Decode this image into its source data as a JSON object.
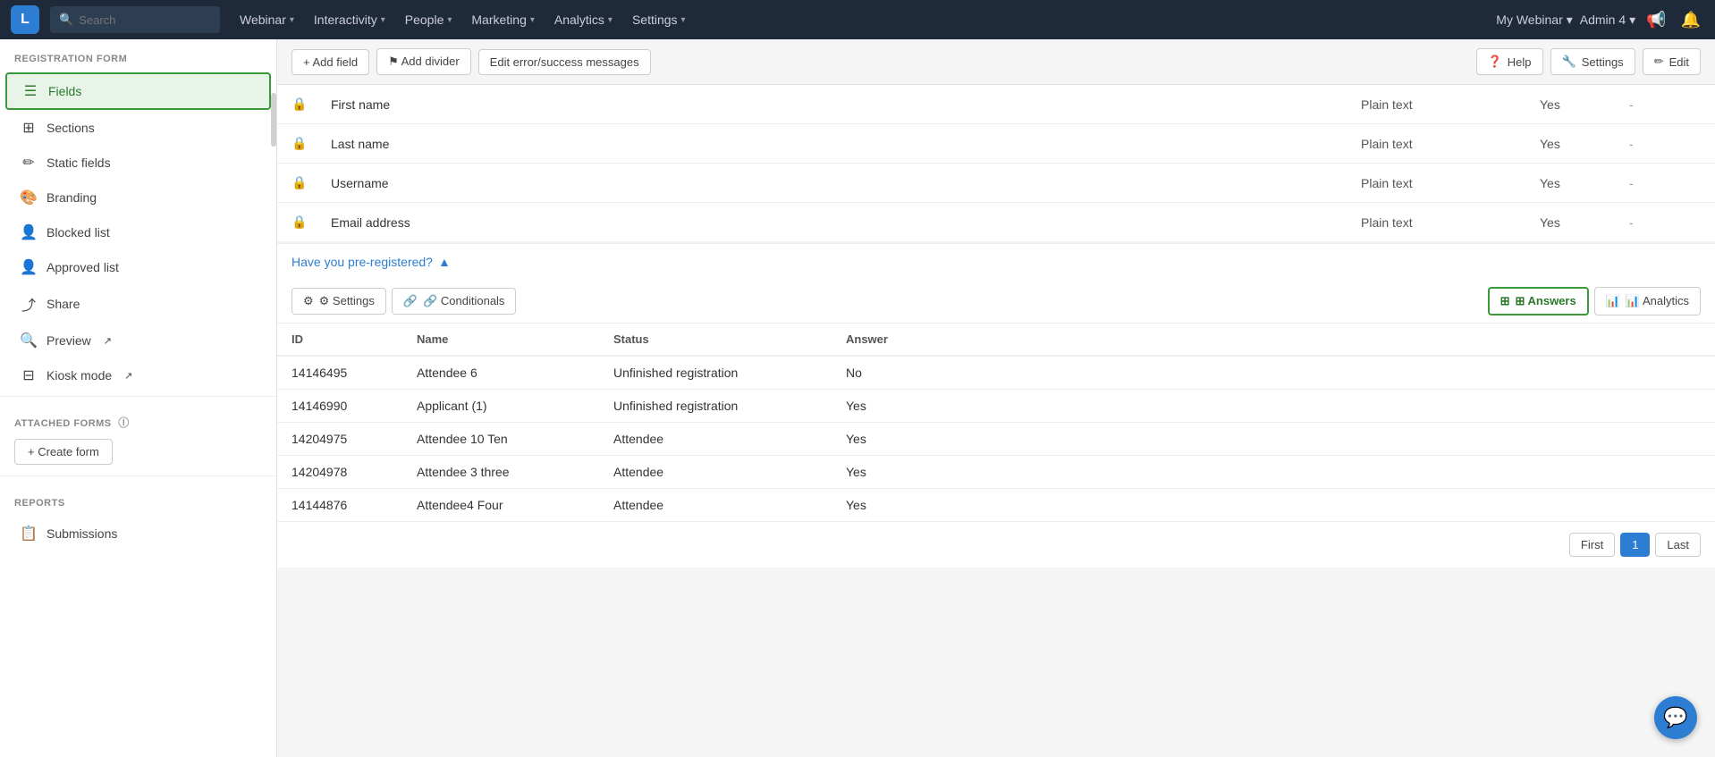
{
  "topnav": {
    "logo": "L",
    "search_placeholder": "Search",
    "nav_items": [
      {
        "label": "Webinar",
        "id": "webinar"
      },
      {
        "label": "Interactivity",
        "id": "interactivity"
      },
      {
        "label": "People",
        "id": "people"
      },
      {
        "label": "Marketing",
        "id": "marketing"
      },
      {
        "label": "Analytics",
        "id": "analytics"
      },
      {
        "label": "Settings",
        "id": "settings"
      }
    ],
    "my_webinar": "My Webinar",
    "admin": "Admin 4"
  },
  "sidebar": {
    "section_title": "REGISTRATION FORM",
    "items": [
      {
        "label": "Fields",
        "icon": "☰",
        "id": "fields",
        "active": true
      },
      {
        "label": "Sections",
        "icon": "⊞",
        "id": "sections"
      },
      {
        "label": "Static fields",
        "icon": "✏",
        "id": "static-fields"
      },
      {
        "label": "Branding",
        "icon": "🎨",
        "id": "branding"
      },
      {
        "label": "Blocked list",
        "icon": "👤",
        "id": "blocked-list"
      },
      {
        "label": "Approved list",
        "icon": "👤",
        "id": "approved-list"
      },
      {
        "label": "Share",
        "icon": "⤴",
        "id": "share"
      },
      {
        "label": "Preview",
        "icon": "🔍",
        "id": "preview",
        "external": true
      },
      {
        "label": "Kiosk mode",
        "icon": "⊟",
        "id": "kiosk-mode",
        "external": true
      }
    ],
    "attached_forms_title": "ATTACHED FORMS",
    "create_form_label": "+ Create form",
    "reports_title": "REPORTS",
    "submissions_label": "Submissions"
  },
  "toolbar": {
    "add_field_label": "+ Add field",
    "add_divider_label": "⚑ Add divider",
    "edit_messages_label": "Edit error/success messages",
    "help_label": "Help",
    "settings_label": "Settings",
    "edit_label": "Edit"
  },
  "form_fields": [
    {
      "icon": "🔒",
      "name": "First name",
      "type": "Plain text",
      "required": "Yes",
      "extra": "-"
    },
    {
      "icon": "🔒",
      "name": "Last name",
      "type": "Plain text",
      "required": "Yes",
      "extra": "-"
    },
    {
      "icon": "🔒",
      "name": "Username",
      "type": "Plain text",
      "required": "Yes",
      "extra": "-"
    },
    {
      "icon": "🔒",
      "name": "Email address",
      "type": "Plain text",
      "required": "Yes",
      "extra": "-"
    }
  ],
  "pre_registered": {
    "link_text": "Have you pre-registered?",
    "chevron": "▲"
  },
  "tabs": {
    "settings_label": "⚙ Settings",
    "conditionals_label": "🔗 Conditionals",
    "answers_label": "⊞ Answers",
    "analytics_label": "📊 Analytics"
  },
  "answers_table": {
    "columns": [
      "ID",
      "Name",
      "Status",
      "Answer"
    ],
    "rows": [
      {
        "id": "14146495",
        "name": "Attendee 6",
        "status": "Unfinished registration",
        "answer": "No"
      },
      {
        "id": "14146990",
        "name": "Applicant (1)",
        "status": "Unfinished registration",
        "answer": "Yes"
      },
      {
        "id": "14204975",
        "name": "Attendee 10 Ten",
        "status": "Attendee",
        "answer": "Yes"
      },
      {
        "id": "14204978",
        "name": "Attendee 3 three",
        "status": "Attendee",
        "answer": "Yes"
      },
      {
        "id": "14144876",
        "name": "Attendee4 Four",
        "status": "Attendee",
        "answer": "Yes"
      }
    ]
  },
  "pagination": {
    "first_label": "First",
    "current_page": "1",
    "last_label": "Last"
  }
}
